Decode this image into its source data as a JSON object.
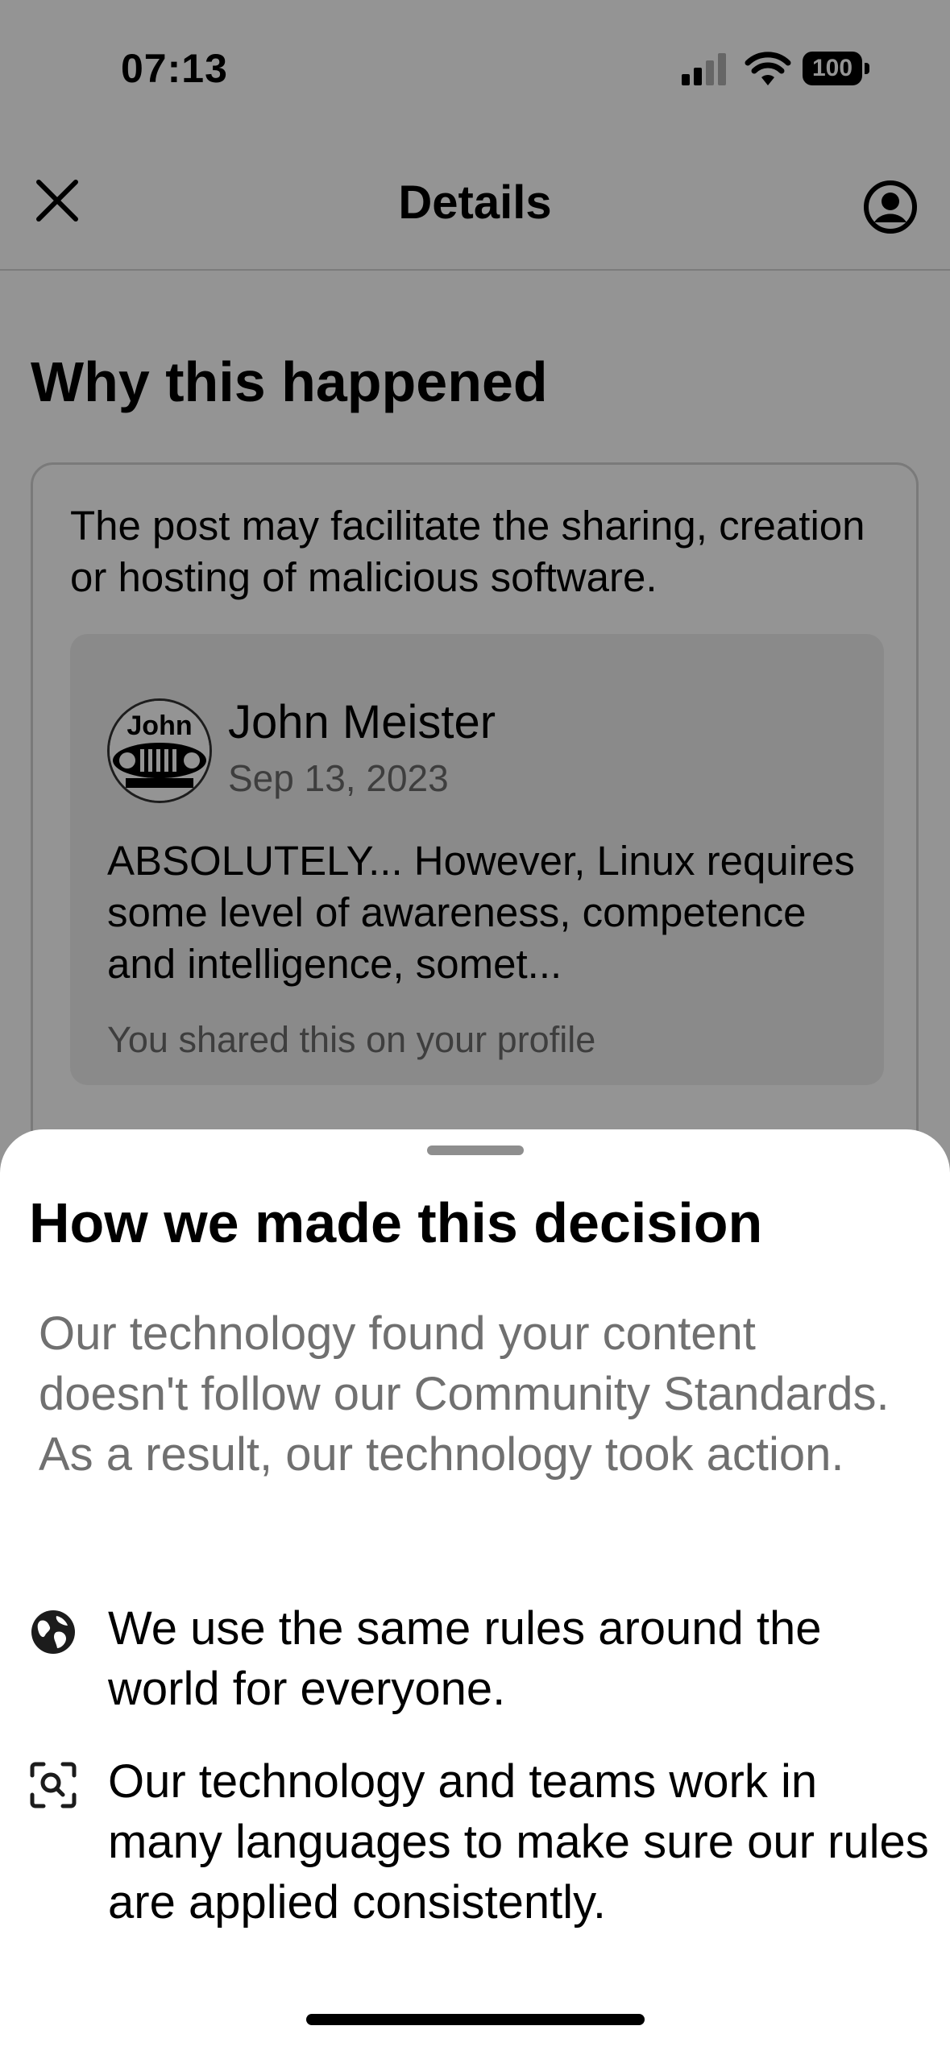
{
  "status_bar": {
    "time": "07:13",
    "battery": "100"
  },
  "header": {
    "title": "Details"
  },
  "why": {
    "title": "Why this happened",
    "reason": "The post may facilitate the sharing, creation or hosting of malicious software.",
    "post": {
      "avatar_text": "John",
      "author": "John Meister",
      "date": "Sep 13, 2023",
      "text": "ABSOLUTELY... However, Linux requires some level of awareness, competence and intelligence, somet...",
      "shared_note": "You shared this on your profile"
    }
  },
  "sheet": {
    "title": "How we made this decision",
    "description": "Our technology found your content doesn't follow our Community Standards. As a result, our technology took action.",
    "points": [
      {
        "icon": "globe-icon",
        "text": "We use the same rules around the world for everyone."
      },
      {
        "icon": "scan-search-icon",
        "text": "Our technology and teams work in many languages to make sure our rules are applied consistently."
      }
    ]
  },
  "colors": {
    "overlay": "#000000",
    "secondary_text": "#707070",
    "card_border": "#d3d3d3"
  }
}
